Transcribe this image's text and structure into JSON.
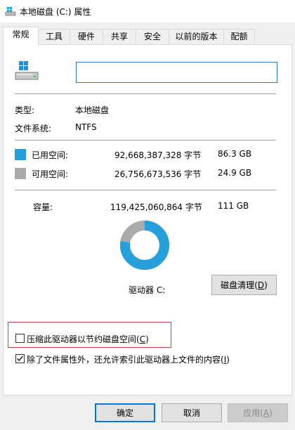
{
  "window": {
    "title": "本地磁盘 (C:) 属性"
  },
  "tabs": [
    {
      "label": "常规",
      "active": true
    },
    {
      "label": "工具",
      "active": false
    },
    {
      "label": "硬件",
      "active": false
    },
    {
      "label": "共享",
      "active": false
    },
    {
      "label": "安全",
      "active": false
    },
    {
      "label": "以前的版本",
      "active": false
    },
    {
      "label": "配额",
      "active": false
    }
  ],
  "general": {
    "name_value": "",
    "type_label": "类型:",
    "type_value": "本地磁盘",
    "fs_label": "文件系统:",
    "fs_value": "NTFS"
  },
  "space": {
    "used_label": "已用空间:",
    "used_bytes": "92,668,387,328 字节",
    "used_gb": "86.3 GB",
    "used_color": "#26a0da",
    "free_label": "可用空间:",
    "free_bytes": "26,756,673,536 字节",
    "free_gb": "24.9 GB",
    "free_color": "#aaaaaa",
    "capacity_label": "容量:",
    "capacity_bytes": "119,425,060,864 字节",
    "capacity_gb": "111 GB",
    "used_fraction": 0.776
  },
  "drive": {
    "label": "驱动器 C:",
    "cleanup_button": "磁盘清理",
    "cleanup_mnemonic": "D"
  },
  "options": {
    "compress_label": "压缩此驱动器以节约磁盘空间",
    "compress_mnemonic": "C",
    "compress_checked": false,
    "index_label": "除了文件属性外，还允许索引此驱动器上文件的内容",
    "index_mnemonic": "I",
    "index_checked": true
  },
  "buttons": {
    "ok": "确定",
    "cancel": "取消",
    "apply": "应用",
    "apply_mnemonic": "A"
  },
  "icons": {
    "title_icon": "drive-icon",
    "drive_icon": "hard-drive-icon",
    "checkmark": "checkmark-icon"
  }
}
